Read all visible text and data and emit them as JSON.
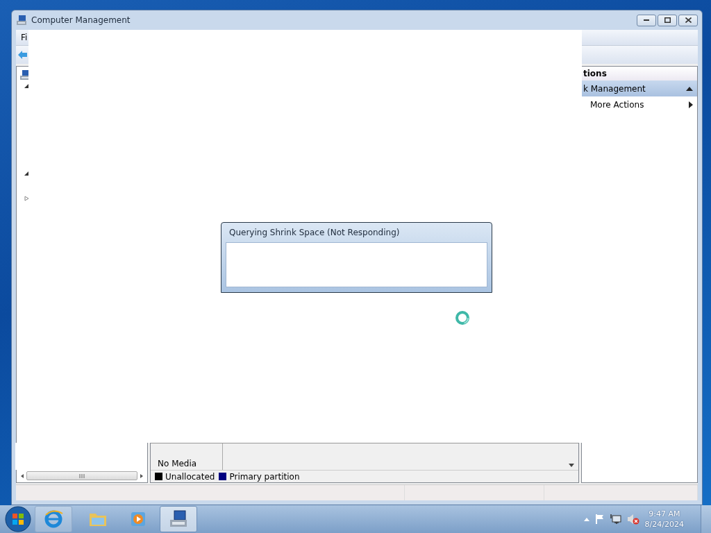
{
  "window": {
    "title": "Computer Management"
  },
  "menu": [
    {
      "label": "Fi"
    }
  ],
  "tree": {
    "nodes": [
      {
        "expanded": true
      },
      {
        "expanded": true
      },
      {
        "expanded": false
      }
    ]
  },
  "disk_view": {
    "rows": [
      {
        "label": "No Media"
      }
    ],
    "legend": [
      {
        "label": "Unallocated",
        "color": "#000000"
      },
      {
        "label": "Primary partition",
        "color": "#000080"
      }
    ]
  },
  "actions": {
    "header": "tions",
    "items": [
      {
        "kind": "group",
        "label": "k Management",
        "expanded": true
      },
      {
        "kind": "submenu",
        "label": "More Actions"
      }
    ]
  },
  "dialog": {
    "title": "Querying Shrink Space (Not Responding)"
  },
  "taskbar": {
    "apps": [
      {
        "kind": "browser",
        "running": true,
        "selected": false
      },
      {
        "kind": "folder",
        "running": false,
        "selected": false
      },
      {
        "kind": "media",
        "running": false,
        "selected": false
      },
      {
        "kind": "console",
        "running": true,
        "selected": true
      }
    ],
    "clock": {
      "time": "9:47 AM",
      "date": "8/24/2024"
    },
    "volume_muted": true
  }
}
